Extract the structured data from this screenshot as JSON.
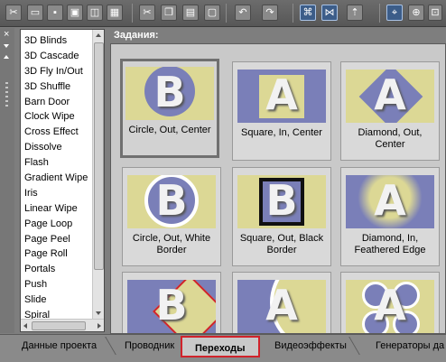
{
  "toolbar": {
    "icons": [
      "cut-icon",
      "new-icon",
      "open-icon",
      "save-icon",
      "properties-icon",
      "render-icon",
      "undo-icon",
      "redo-icon",
      "snap-icon",
      "event-icon",
      "auto-ripple-icon",
      "select-tool-icon",
      "envelope-tool-icon"
    ]
  },
  "panel": {
    "title": "Задания:"
  },
  "transitions": {
    "items": [
      "3D Blinds",
      "3D Cascade",
      "3D Fly In/Out",
      "3D Shuffle",
      "Barn Door",
      "Clock Wipe",
      "Cross Effect",
      "Dissolve",
      "Flash",
      "Gradient Wipe",
      "Iris",
      "Linear Wipe",
      "Page Loop",
      "Page Peel",
      "Page Roll",
      "Portals",
      "Push",
      "Slide",
      "Spiral"
    ],
    "selected": "Iris"
  },
  "presets": [
    {
      "label": "Circle, Out, Center",
      "letter": "B"
    },
    {
      "label": "Square, In, Center",
      "letter": "A"
    },
    {
      "label": "Diamond, Out, Center",
      "letter": "A"
    },
    {
      "label": "Circle, Out, White Border",
      "letter": "B"
    },
    {
      "label": "Square, Out, Black Border",
      "letter": "B"
    },
    {
      "label": "Diamond, In, Feathered Edge",
      "letter": "A"
    },
    {
      "label": "",
      "letter": "B"
    },
    {
      "label": "",
      "letter": "A"
    },
    {
      "label": "",
      "letter": "A"
    }
  ],
  "tabs": {
    "items": [
      "Данные проекта",
      "Проводник",
      "Переходы",
      "Видеоэффекты",
      "Генераторы да"
    ],
    "active": "Переходы"
  },
  "colors": {
    "highlight": "#d0232b",
    "thumb_yellow": "#dcd895",
    "thumb_blue": "#7a7fb8"
  }
}
